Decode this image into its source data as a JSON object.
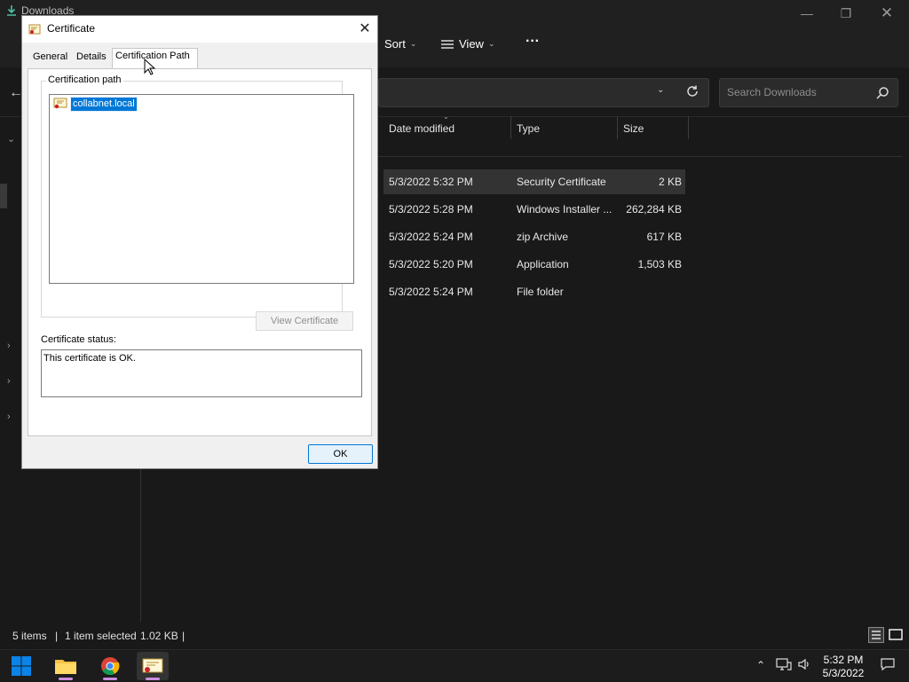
{
  "explorer": {
    "title": "Downloads",
    "toolbar": {
      "sort": "Sort",
      "view": "View",
      "more": "···"
    },
    "search_placeholder": "Search Downloads",
    "columns": [
      "Date modified",
      "Type",
      "Size"
    ],
    "rows": [
      {
        "date": "5/3/2022 5:32 PM",
        "type": "Security Certificate",
        "size": "2 KB",
        "selected": true
      },
      {
        "date": "5/3/2022 5:28 PM",
        "type": "Windows Installer ...",
        "size": "262,284 KB"
      },
      {
        "date": "5/3/2022 5:24 PM",
        "type": "zip Archive",
        "size": "617 KB"
      },
      {
        "date": "5/3/2022 5:20 PM",
        "type": "Application",
        "size": "1,503 KB"
      },
      {
        "date": "5/3/2022 5:24 PM",
        "type": "File folder",
        "size": ""
      }
    ],
    "status": {
      "items": "5 items",
      "sep": "|",
      "selected": "1 item selected",
      "size": "1.02 KB"
    }
  },
  "dialog": {
    "title": "Certificate",
    "tabs": [
      "General",
      "Details",
      "Certification Path"
    ],
    "active_tab": "Certification Path",
    "group_label": "Certification path",
    "tree_item": "collabnet.local",
    "view_certificate": "View Certificate",
    "status_label": "Certificate status:",
    "status_text": "This certificate is OK.",
    "ok": "OK"
  },
  "taskbar": {
    "time": "5:32 PM",
    "date": "5/3/2022"
  },
  "colors": {
    "accent": "#0078d7",
    "dark_bg": "#191919",
    "selected_row": "#333333"
  }
}
